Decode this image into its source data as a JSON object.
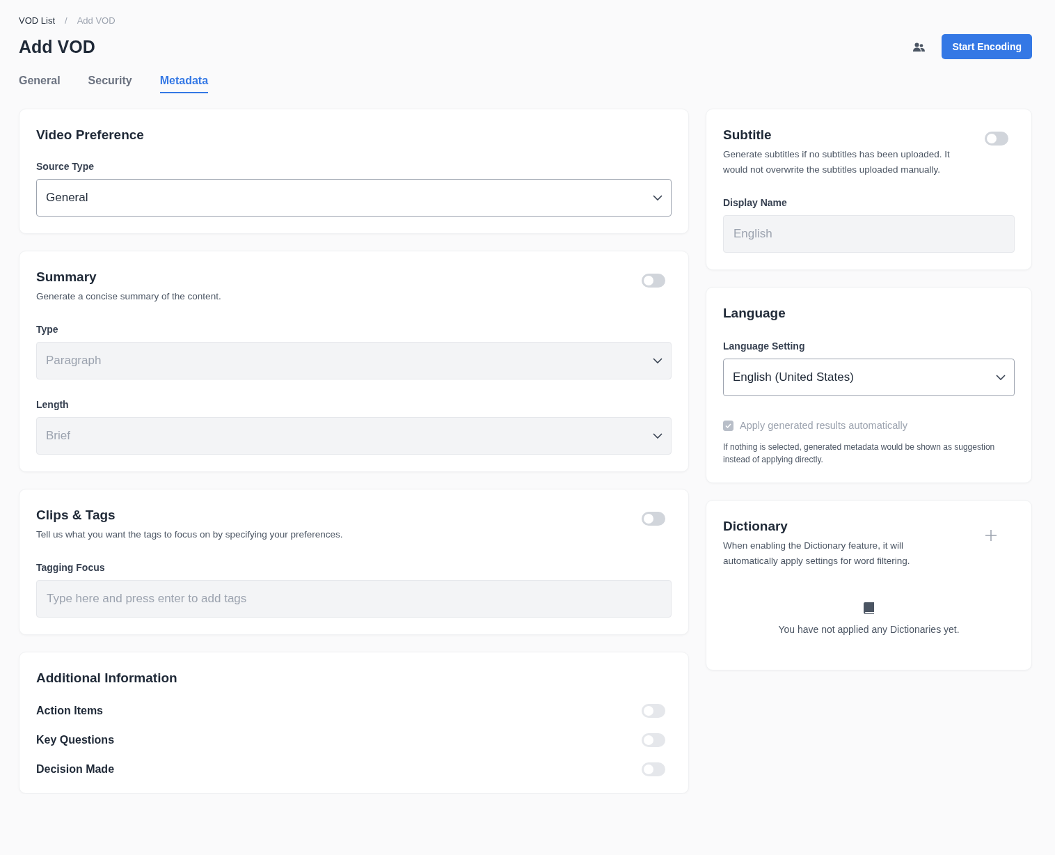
{
  "breadcrumb": {
    "items": [
      {
        "label": "VOD List"
      },
      {
        "label": "Add VOD"
      }
    ],
    "separator": "/"
  },
  "title": "Add VOD",
  "primary_button": "Start Encoding",
  "tabs": [
    {
      "label": "General",
      "selected": false
    },
    {
      "label": "Security",
      "selected": false
    },
    {
      "label": "Metadata",
      "selected": true
    }
  ],
  "left_cards": [
    {
      "title": "Video Preference",
      "fields": [
        {
          "kind": "select",
          "label": "Source Type",
          "value": "General",
          "disabled": false
        }
      ]
    },
    {
      "title": "Summary",
      "description": "Generate a concise summary of the content.",
      "toggle": {
        "on": false
      },
      "fields": [
        {
          "kind": "select",
          "label": "Type",
          "value": "Paragraph",
          "disabled": true
        },
        {
          "kind": "select",
          "label": "Length",
          "value": "Brief",
          "disabled": true
        }
      ]
    },
    {
      "title": "Clips & Tags",
      "description": "Tell us what you want the tags to focus on by specifying your preferences.",
      "toggle": {
        "on": false
      },
      "fields": [
        {
          "kind": "input",
          "label": "Tagging Focus",
          "placeholder": "Type here and press enter to add tags"
        }
      ]
    },
    {
      "title": "Additional Information",
      "fields": [
        {
          "kind": "switch",
          "label": "Action Items",
          "on": false,
          "disabled": true
        },
        {
          "kind": "switch",
          "label": "Key Questions",
          "on": false,
          "disabled": true
        },
        {
          "kind": "switch",
          "label": "Decision Made",
          "on": false,
          "disabled": true
        }
      ]
    }
  ],
  "right_cards": [
    {
      "title": "Subtitle",
      "description": "Generate subtitles if no subtitles has been uploaded. It would not overwrite the subtitles uploaded manually.",
      "toggle": {
        "on": false
      },
      "fields": [
        {
          "kind": "input",
          "label": "Display Name",
          "placeholder": "English"
        }
      ]
    },
    {
      "title": "Language",
      "fields": [
        {
          "kind": "select",
          "label": "Language Setting",
          "value": "English (United States)",
          "disabled": false
        },
        {
          "kind": "checkbox",
          "label": "Apply generated results automatically",
          "checked": true,
          "disabled": true
        },
        {
          "kind": "note",
          "text": "If nothing is selected, generated metadata would be shown as suggestion instead of applying directly."
        }
      ]
    },
    {
      "title": "Dictionary",
      "description": "When enabling the Dictionary feature, it will automatically apply settings for word filtering.",
      "add_button": true,
      "fields": [
        {
          "kind": "empty",
          "text": "You have not applied any Dictionaries yet."
        }
      ]
    }
  ]
}
